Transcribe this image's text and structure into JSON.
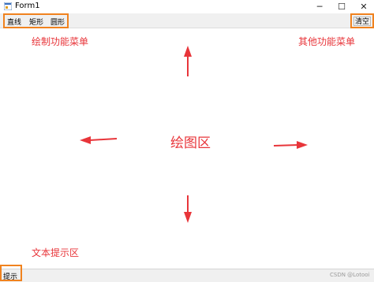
{
  "window": {
    "title": "Form1",
    "minimize_glyph": "─",
    "maximize_glyph": "☐",
    "close_glyph": "✕"
  },
  "menu": {
    "items": [
      {
        "label": "直线"
      },
      {
        "label": "矩形"
      },
      {
        "label": "圆形"
      }
    ],
    "clear_label": "清空"
  },
  "annotations": {
    "draw_menu": "绘制功能菜单",
    "other_menu": "其他功能菜单",
    "canvas_area": "绘图区",
    "status_area": "文本提示区"
  },
  "status": {
    "text": "提示"
  },
  "watermark": "CSDN @Lotooi",
  "colors": {
    "annotation_red": "#e8353a",
    "highlight_orange": "#f0821e"
  }
}
